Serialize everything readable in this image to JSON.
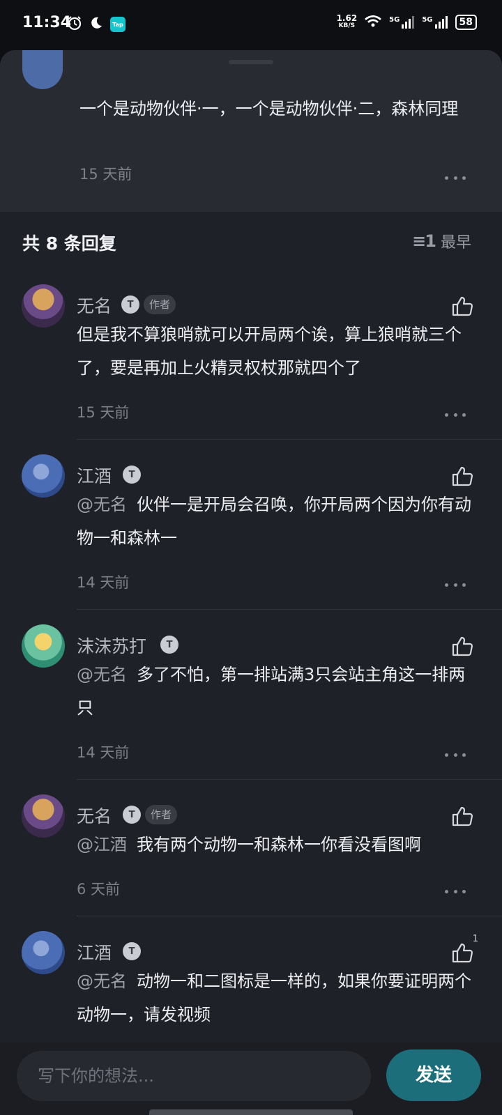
{
  "status_bar": {
    "time": "11:34",
    "tap_label": "Tap",
    "speed_value": "1.62",
    "speed_unit": "KB/S",
    "sim1": "5G",
    "sim2": "5G",
    "battery": "58"
  },
  "parent": {
    "text": "一个是动物伙伴·一，一个是动物伙伴·二，森林同理",
    "time": "15 天前"
  },
  "replies_header": {
    "count_label": "共 8 条回复",
    "sort_label": "最早"
  },
  "comments": [
    {
      "name": "无名",
      "level": "T",
      "author_tag": "作者",
      "mention": "",
      "text": "但是我不算狼哨就可以开局两个诶，算上狼哨就三个了，要是再加上火精灵权杖那就四个了",
      "time": "15 天前",
      "likes": ""
    },
    {
      "name": "江酒",
      "level": "T",
      "author_tag": "",
      "mention": "@无名",
      "text": "伙伴一是开局会召唤，你开局两个因为你有动物一和森林一",
      "time": "14 天前",
      "likes": ""
    },
    {
      "name": "沫沫苏打",
      "level": "T",
      "author_tag": "",
      "mention": "@无名",
      "text": "多了不怕，第一排站满3只会站主角这一排两只",
      "time": "14 天前",
      "likes": ""
    },
    {
      "name": "无名",
      "level": "T",
      "author_tag": "作者",
      "mention": "@江酒",
      "text": "我有两个动物一和森林一你看没看图啊",
      "time": "6 天前",
      "likes": ""
    },
    {
      "name": "江酒",
      "level": "T",
      "author_tag": "",
      "mention": "@无名",
      "text": "动物一和二图标是一样的，如果你要证明两个动物一，请发视频",
      "time": "",
      "likes": "1"
    }
  ],
  "composer": {
    "placeholder": "写下你的想法...",
    "send_label": "发送"
  },
  "colors": {
    "accent": "#1c6e7b",
    "sheet_bg": "#1f2128",
    "parent_bg": "#292b33"
  }
}
